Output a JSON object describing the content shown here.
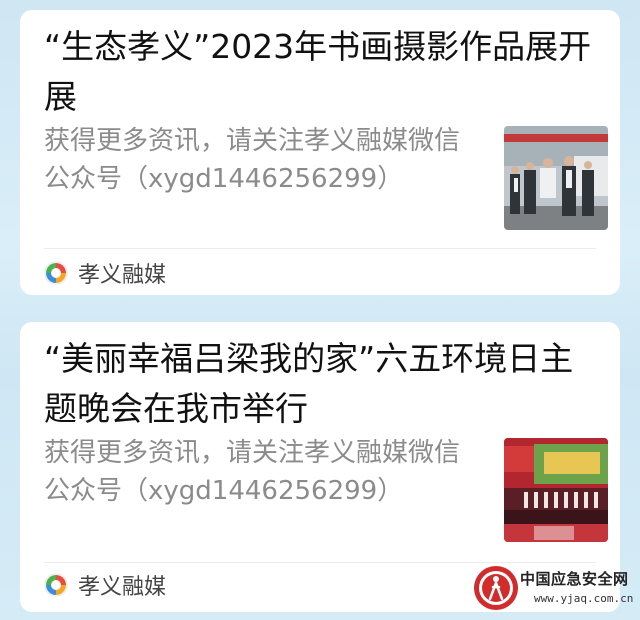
{
  "feed": [
    {
      "title": "“生态孝义”2023年书画摄影作品展开展",
      "description": "获得更多资讯，请关注孝义融媒微信公众号（xygd1446256299）",
      "source": "孝义融媒",
      "thumbnail_icon": "exhibition-photo"
    },
    {
      "title": "“美丽幸福吕梁我的家”六五环境日主题晚会在我市举行",
      "description": "获得更多资讯，请关注孝义融媒微信公众号（xygd1446256299）",
      "source": "孝义融媒",
      "thumbnail_icon": "stage-performance-photo"
    }
  ],
  "watermark": {
    "name": "中国应急安全网",
    "url": "www.yjaq.com.cn"
  },
  "colors": {
    "title": "#111111",
    "description": "#8b8b8b",
    "brand_red": "#d22b2b"
  }
}
